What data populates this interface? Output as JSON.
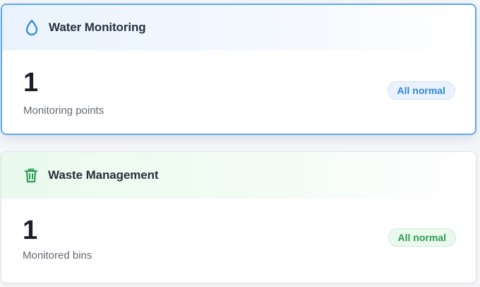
{
  "cards": [
    {
      "title": "Water Monitoring",
      "icon": "water-drop-icon",
      "accent": "#2f86d8",
      "value": "1",
      "label": "Monitoring points",
      "status": "All normal"
    },
    {
      "title": "Waste Management",
      "icon": "trash-icon",
      "accent": "#2a9d52",
      "value": "1",
      "label": "Monitored bins",
      "status": "All normal"
    }
  ]
}
